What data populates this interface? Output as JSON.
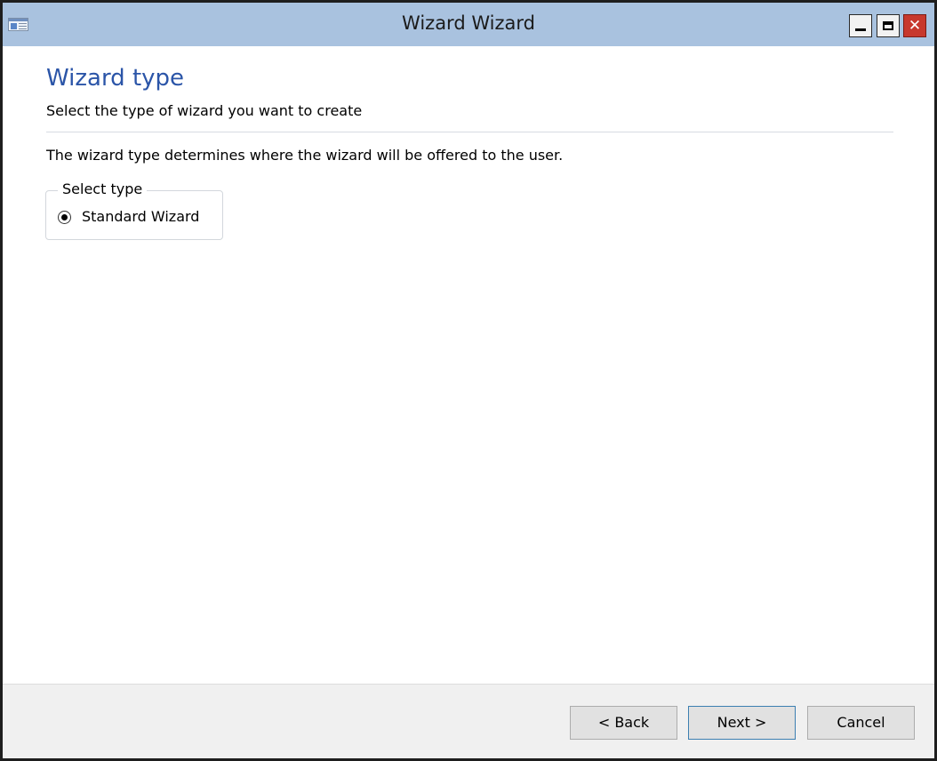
{
  "window": {
    "title": "Wizard Wizard",
    "close_glyph": "✕"
  },
  "page": {
    "title": "Wizard type",
    "subtitle": "Select the type of wizard you want to create",
    "description": "The wizard type determines where the wizard will be offered to the user."
  },
  "select_type": {
    "legend": "Select type",
    "options": [
      {
        "label": "Standard Wizard",
        "selected": true
      }
    ]
  },
  "footer": {
    "back_label": "< Back",
    "next_label": "Next >",
    "cancel_label": "Cancel"
  },
  "colors": {
    "titlebar": "#a9c2df",
    "accent_title": "#2b55a8",
    "close_button": "#c7382d",
    "footer_background": "#f0f0f0"
  },
  "icons": [
    "app-window-icon",
    "minimize-icon",
    "maximize-icon",
    "close-icon",
    "radio-selected-icon"
  ]
}
